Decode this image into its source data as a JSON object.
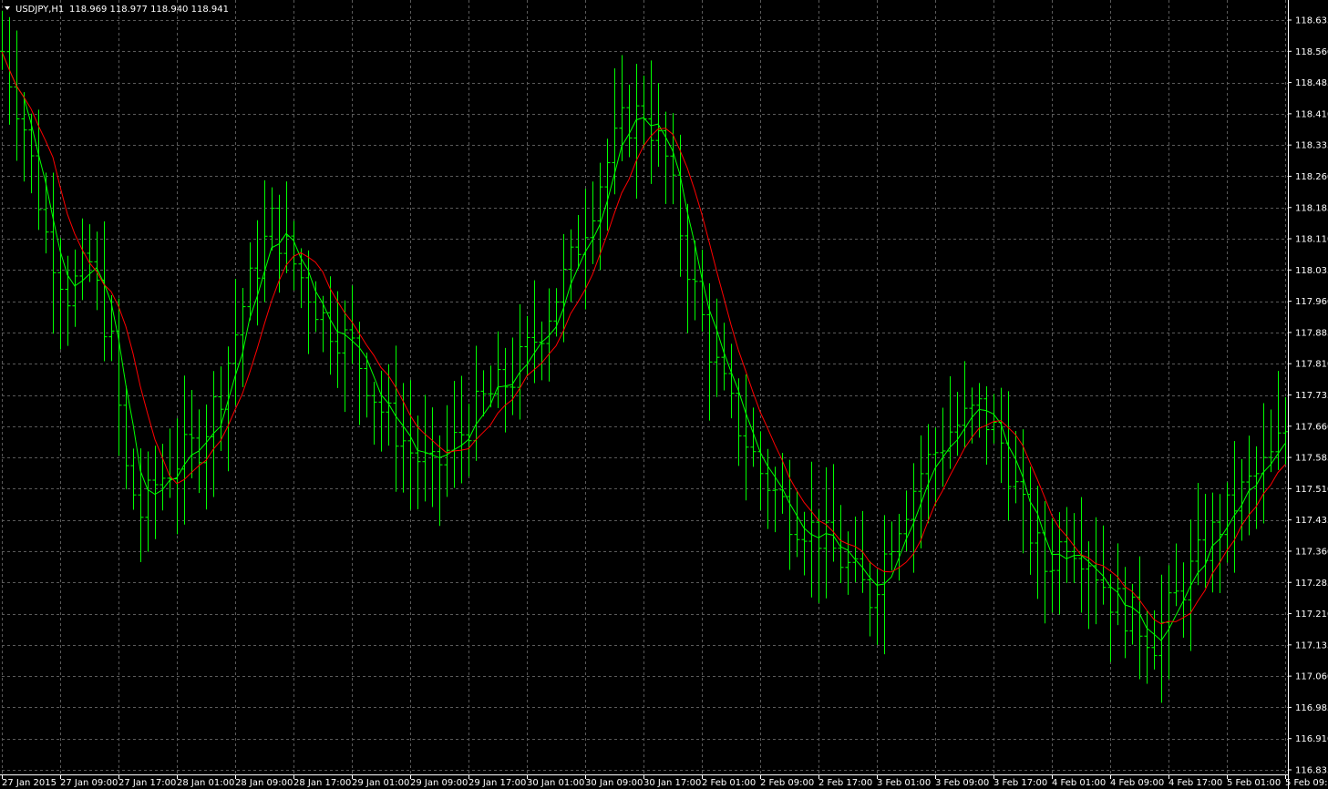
{
  "header": {
    "symbol": "USDJPY,H1",
    "ohlc": "118.969 118.977 118.940 118.941"
  },
  "colors": {
    "background": "#000000",
    "grid": "#5a5a5a",
    "bars": "#00ff00",
    "ma_fast": "#00ff00",
    "ma_slow": "#ff0000",
    "text": "#ffffff"
  },
  "chart_data": {
    "type": "ohlc",
    "symbol": "USDJPY",
    "timeframe": "H1",
    "grid": true,
    "ylim": [
      116.835,
      118.635
    ],
    "y_ticks": [
      "118.635",
      "118.560",
      "118.485",
      "118.410",
      "118.335",
      "118.260",
      "118.185",
      "118.110",
      "118.035",
      "117.960",
      "117.885",
      "117.810",
      "117.735",
      "117.660",
      "117.585",
      "117.510",
      "117.435",
      "117.360",
      "117.285",
      "117.210",
      "117.135",
      "117.060",
      "116.985",
      "116.910",
      "116.835"
    ],
    "x_ticks": [
      "27 Jan 2015",
      "27 Jan 09:00",
      "27 Jan 17:00",
      "28 Jan 01:00",
      "28 Jan 09:00",
      "28 Jan 17:00",
      "29 Jan 01:00",
      "29 Jan 09:00",
      "29 Jan 17:00",
      "30 Jan 01:00",
      "30 Jan 09:00",
      "30 Jan 17:00",
      "2 Feb 01:00",
      "2 Feb 09:00",
      "2 Feb 17:00",
      "3 Feb 01:00",
      "3 Feb 09:00",
      "3 Feb 17:00",
      "4 Feb 01:00",
      "4 Feb 09:00",
      "4 Feb 17:00",
      "5 Feb 01:00",
      "5 Feb 09:00"
    ],
    "bars_per_tick": 8,
    "bar_width_hours": 1,
    "price_path": [
      [
        0,
        118.56
      ],
      [
        3,
        118.38
      ],
      [
        6,
        118.12
      ],
      [
        9,
        117.98
      ],
      [
        12,
        118.05
      ],
      [
        15,
        117.85
      ],
      [
        17,
        117.55
      ],
      [
        19,
        117.45
      ],
      [
        21,
        117.52
      ],
      [
        24,
        117.58
      ],
      [
        27,
        117.62
      ],
      [
        30,
        117.75
      ],
      [
        33,
        117.95
      ],
      [
        37,
        118.15
      ],
      [
        40,
        118.05
      ],
      [
        44,
        117.92
      ],
      [
        48,
        117.85
      ],
      [
        52,
        117.7
      ],
      [
        56,
        117.6
      ],
      [
        59,
        117.55
      ],
      [
        62,
        117.62
      ],
      [
        66,
        117.72
      ],
      [
        70,
        117.78
      ],
      [
        74,
        117.9
      ],
      [
        78,
        118.05
      ],
      [
        82,
        118.25
      ],
      [
        85,
        118.38
      ],
      [
        88,
        118.42
      ],
      [
        91,
        118.3
      ],
      [
        94,
        118.05
      ],
      [
        97,
        117.85
      ],
      [
        100,
        117.7
      ],
      [
        104,
        117.55
      ],
      [
        108,
        117.45
      ],
      [
        112,
        117.4
      ],
      [
        116,
        117.32
      ],
      [
        119,
        117.25
      ],
      [
        122,
        117.4
      ],
      [
        126,
        117.55
      ],
      [
        130,
        117.65
      ],
      [
        134,
        117.7
      ],
      [
        137,
        117.62
      ],
      [
        140,
        117.45
      ],
      [
        143,
        117.32
      ],
      [
        146,
        117.4
      ],
      [
        149,
        117.35
      ],
      [
        152,
        117.25
      ],
      [
        155,
        117.2
      ],
      [
        158,
        117.15
      ],
      [
        162,
        117.28
      ],
      [
        166,
        117.4
      ],
      [
        170,
        117.5
      ],
      [
        174,
        117.58
      ],
      [
        178,
        117.72
      ],
      [
        182,
        117.85
      ],
      [
        186,
        117.8
      ],
      [
        190,
        117.65
      ],
      [
        194,
        117.5
      ],
      [
        198,
        117.45
      ],
      [
        202,
        117.4
      ],
      [
        206,
        117.32
      ],
      [
        210,
        117.3
      ],
      [
        214,
        117.25
      ],
      [
        218,
        117.2
      ],
      [
        222,
        117.17
      ],
      [
        224,
        117.18
      ]
    ],
    "series": [
      {
        "name": "",
        "color": "#00ff00",
        "period": 4
      },
      {
        "name": "",
        "color": "#ff0000",
        "period": 8
      }
    ]
  }
}
